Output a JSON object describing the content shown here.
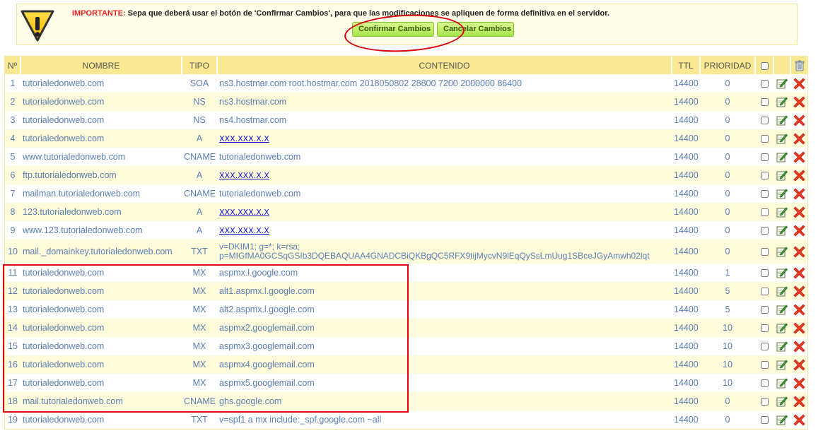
{
  "notice": {
    "important_label": "IMPORTANTE:",
    "message": " Sepa que deberá usar el botón de 'Confirmar Cambios', para que las modificaciones se apliquen de forma definitiva en el servidor.",
    "confirm_label": "Confirmar Cambios",
    "cancel_label": "Cancelar Cambios",
    "icon": "warning-icon"
  },
  "table": {
    "headers": {
      "num": "Nº",
      "nombre": "NOMBRE",
      "tipo": "TIPO",
      "contenido": "CONTENIDO",
      "ttl": "TTL",
      "prioridad": "PRIORIDAD"
    },
    "rows": [
      {
        "num": "1",
        "nombre": "tutorialedonweb.com",
        "tipo": "SOA",
        "contenido": "ns3.hostmar.com root.hostmar.com 2018050802 28800 7200 2000000 86400",
        "ttl": "14400",
        "prioridad": "0"
      },
      {
        "num": "2",
        "nombre": "tutorialedonweb.com",
        "tipo": "NS",
        "contenido": "ns3.hostmar.com",
        "ttl": "14400",
        "prioridad": "0"
      },
      {
        "num": "3",
        "nombre": "tutorialedonweb.com",
        "tipo": "NS",
        "contenido": "ns4.hostmar.com",
        "ttl": "14400",
        "prioridad": "0"
      },
      {
        "num": "4",
        "nombre": "tutorialedonweb.com",
        "tipo": "A",
        "contenido": "XXX.XXX.X.X",
        "ttl": "14400",
        "prioridad": "0"
      },
      {
        "num": "5",
        "nombre": "www.tutorialedonweb.com",
        "tipo": "CNAME",
        "contenido": "tutorialedonweb.com",
        "ttl": "14400",
        "prioridad": "0"
      },
      {
        "num": "6",
        "nombre": "ftp.tutorialedonweb.com",
        "tipo": "A",
        "contenido": "XXX.XXX.X.X",
        "ttl": "14400",
        "prioridad": "0"
      },
      {
        "num": "7",
        "nombre": "mailman.tutorialedonweb.com",
        "tipo": "CNAME",
        "contenido": "tutorialedonweb.com",
        "ttl": "14400",
        "prioridad": "0"
      },
      {
        "num": "8",
        "nombre": "123.tutorialedonweb.com",
        "tipo": "A",
        "contenido": "XXX.XXX.X.X",
        "ttl": "14400",
        "prioridad": "0"
      },
      {
        "num": "9",
        "nombre": "www.123.tutorialedonweb.com",
        "tipo": "A",
        "contenido": "XXX.XXX.X.X",
        "ttl": "14400",
        "prioridad": "0"
      },
      {
        "num": "10",
        "nombre": "mail._domainkey.tutorialedonweb.com",
        "tipo": "TXT",
        "contenido": "v=DKIM1; g=*; k=rsa;",
        "contenido2": "p=MIGfMA0GCSqGSIb3DQEBAQUAA4GNADCBiQKBgQC5RFX9tijMycvN9lEqQySsLmUug1SBceJGyAmwh02lqt",
        "ttl": "14400",
        "prioridad": "0"
      },
      {
        "num": "11",
        "nombre": "tutorialedonweb.com",
        "tipo": "MX",
        "contenido": "aspmx.l.google.com",
        "ttl": "14400",
        "prioridad": "1"
      },
      {
        "num": "12",
        "nombre": "tutorialedonweb.com",
        "tipo": "MX",
        "contenido": "alt1.aspmx.l.google.com",
        "ttl": "14400",
        "prioridad": "5"
      },
      {
        "num": "13",
        "nombre": "tutorialedonweb.com",
        "tipo": "MX",
        "contenido": "alt2.aspmx.l.google.com",
        "ttl": "14400",
        "prioridad": "5"
      },
      {
        "num": "14",
        "nombre": "tutorialedonweb.com",
        "tipo": "MX",
        "contenido": "aspmx2.googlemail.com",
        "ttl": "14400",
        "prioridad": "10"
      },
      {
        "num": "15",
        "nombre": "tutorialedonweb.com",
        "tipo": "MX",
        "contenido": "aspmx3.googlemail.com",
        "ttl": "14400",
        "prioridad": "10"
      },
      {
        "num": "16",
        "nombre": "tutorialedonweb.com",
        "tipo": "MX",
        "contenido": "aspmx4.googlemail.com",
        "ttl": "14400",
        "prioridad": "10"
      },
      {
        "num": "17",
        "nombre": "tutorialedonweb.com",
        "tipo": "MX",
        "contenido": "aspmx5.googlemail.com",
        "ttl": "14400",
        "prioridad": "10"
      },
      {
        "num": "18",
        "nombre": "mail.tutorialedonweb.com",
        "tipo": "CNAME",
        "contenido": "ghs.google.com",
        "ttl": "14400",
        "prioridad": "0"
      },
      {
        "num": "19",
        "nombre": "tutorialedonweb.com",
        "tipo": "TXT",
        "contenido": "v=spf1 a mx include:_spf.google.com ~all",
        "ttl": "14400",
        "prioridad": "0"
      }
    ],
    "row_icons": {
      "edit": "edit-icon",
      "delete": "delete-icon",
      "header_delete": "trash-icon"
    }
  },
  "colors": {
    "header_bg": "#fbe892",
    "row_alt_bg": "#fefcdb",
    "link_text": "#5a7fb5",
    "important_red": "#e8262a",
    "button_green": "#a7e34a",
    "annotation_red": "#e0000f"
  }
}
